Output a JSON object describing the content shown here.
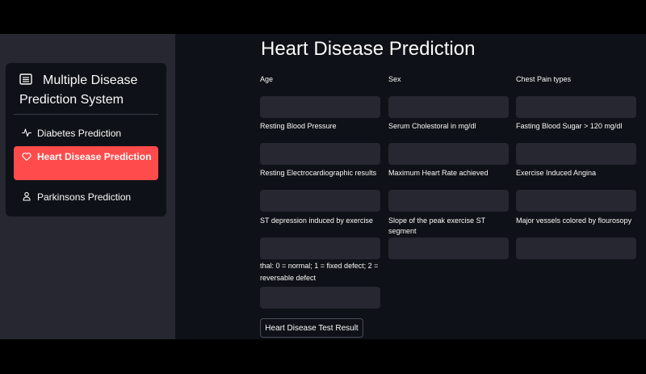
{
  "sidebar": {
    "title": "Multiple Disease Prediction System",
    "title_icon": "hospital-icon",
    "items": [
      {
        "label": "Diabetes Prediction",
        "icon": "activity-icon"
      },
      {
        "label": "Heart Disease Prediction",
        "icon": "heart-icon"
      },
      {
        "label": "Parkinsons Prediction",
        "icon": "person-icon"
      }
    ],
    "selected": "Heart Disease Prediction",
    "accent_color": "#ff4b4b"
  },
  "main": {
    "title": "Heart Disease Prediction",
    "fields": [
      {
        "label": "Age",
        "value": ""
      },
      {
        "label": "Sex",
        "value": ""
      },
      {
        "label": "Chest Pain types",
        "value": ""
      },
      {
        "label": "Resting Blood Pressure",
        "value": ""
      },
      {
        "label": "Serum Cholestoral in mg/dl",
        "value": ""
      },
      {
        "label": "Fasting Blood Sugar > 120 mg/dl",
        "value": ""
      },
      {
        "label": "Resting Electrocardiographic results",
        "value": ""
      },
      {
        "label": "Maximum Heart Rate achieved",
        "value": ""
      },
      {
        "label": "Exercise Induced Angina",
        "value": ""
      },
      {
        "label": "ST depression induced by exercise",
        "value": ""
      },
      {
        "label": "Slope of the peak exercise ST segment",
        "value": ""
      },
      {
        "label": "Major vessels colored by flourosopy",
        "value": ""
      },
      {
        "label": "thal: 0 = normal; 1 = fixed defect; 2 = reversable defect",
        "value": ""
      }
    ],
    "submit_label": "Heart Disease Test Result"
  }
}
